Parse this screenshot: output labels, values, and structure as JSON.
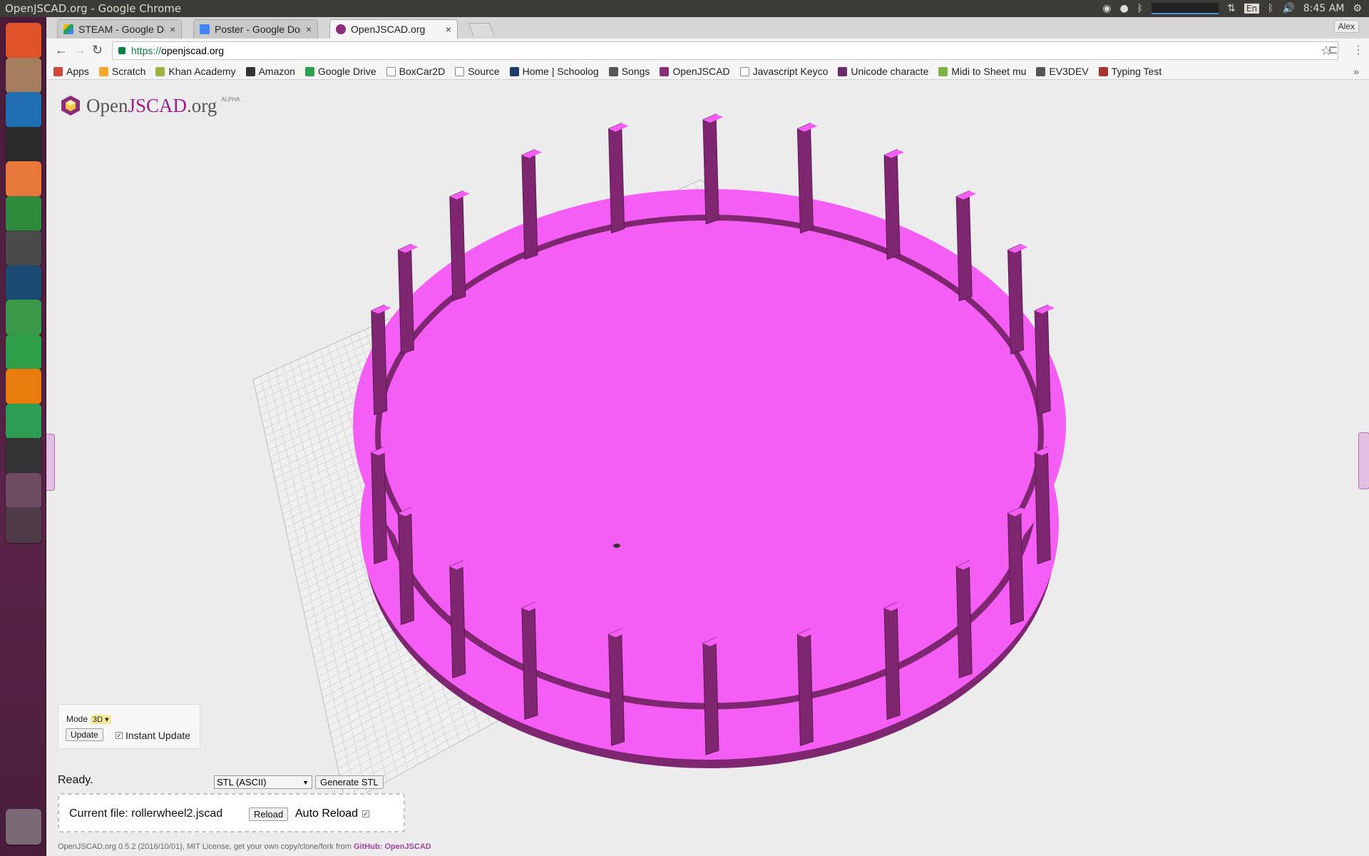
{
  "window": {
    "title": "OpenJSCAD.org - Google Chrome"
  },
  "tray": {
    "keyboard": "En",
    "time": "8:45 AM"
  },
  "tabs": [
    {
      "label": "STEAM - Google Dri",
      "favicon": "google-drive-icon",
      "close": "×"
    },
    {
      "label": "Poster - Google Doc",
      "favicon": "google-docs-icon",
      "close": "×"
    },
    {
      "label": "OpenJSCAD.org",
      "favicon": "openjscad-icon",
      "close": "×",
      "active": true
    }
  ],
  "profile": {
    "name": "Alex"
  },
  "address": {
    "protocol": "https://",
    "host": "openjscad.org"
  },
  "bookmarks": [
    {
      "label": "Apps",
      "icon": "apps-grid-icon",
      "color": "#d04a3a"
    },
    {
      "label": "Scratch",
      "icon": "scratch-icon",
      "color": "#f7a531"
    },
    {
      "label": "Khan Academy",
      "icon": "khan-icon",
      "color": "#9cb443"
    },
    {
      "label": "Amazon",
      "icon": "amazon-icon",
      "color": "#333333"
    },
    {
      "label": "Google Drive",
      "icon": "google-drive-icon",
      "color": "#2ca24c"
    },
    {
      "label": "BoxCar2D",
      "icon": "page-icon",
      "color": "#ffffff"
    },
    {
      "label": "Source",
      "icon": "page-icon",
      "color": "#ffffff"
    },
    {
      "label": "Home | Schoolog",
      "icon": "schoology-icon",
      "color": "#1e3d6b"
    },
    {
      "label": "Songs",
      "icon": "folder-icon",
      "color": "#555555"
    },
    {
      "label": "OpenJSCAD",
      "icon": "openjscad-icon",
      "color": "#8c2d7a"
    },
    {
      "label": "Javascript Keyco",
      "icon": "page-icon",
      "color": "#ffffff"
    },
    {
      "label": "Unicode characte",
      "icon": "unicode-icon",
      "color": "#6a2c6a"
    },
    {
      "label": "Midi to Sheet mu",
      "icon": "midi-icon",
      "color": "#7cb342"
    },
    {
      "label": "EV3DEV",
      "icon": "folder-icon",
      "color": "#555555"
    },
    {
      "label": "Typing Test",
      "icon": "typing-icon",
      "color": "#a33"
    }
  ],
  "app": {
    "logo_text_a": "Open",
    "logo_text_b": "JSCAD",
    "logo_text_c": ".org",
    "logo_tag": "ALPHA",
    "mode_label": "Mode",
    "mode_value": "3D ▾",
    "update_label": "Update",
    "instant_update_label": "Instant Update",
    "instant_update_checked": "✓",
    "status": "Ready.",
    "format_value": "STL (ASCII)",
    "generate_label": "Generate STL",
    "current_file": "Current file: rollerwheel2.jscad",
    "reload_label": "Reload",
    "auto_reload_label": "Auto Reload",
    "auto_reload_checked": "✓",
    "footer_text": "OpenJSCAD.org 0.5.2 (2016/10/01), MIT License, get your own copy/clone/fork from ",
    "footer_link": "GitHub: OpenJSCAD"
  },
  "model": {
    "color": "#f55ef5",
    "shade": "#7e2670",
    "grid_color": "#c8c8c8"
  },
  "launcher": [
    {
      "name": "ubuntu-dash-icon",
      "color": "#e0532a"
    },
    {
      "name": "files-icon",
      "color": "#a67d5d"
    },
    {
      "name": "vnc-viewer-icon",
      "color": "#1f6fb2"
    },
    {
      "name": "xterm-icon",
      "color": "#2b2b2b"
    },
    {
      "name": "file-manager-icon",
      "color": "#e8793b"
    },
    {
      "name": "chrome-icon",
      "color": "#2e8b3c"
    },
    {
      "name": "sublime-text-icon",
      "color": "#4a4a4a"
    },
    {
      "name": "steam-icon",
      "color": "#1b4a72"
    },
    {
      "name": "android-studio-icon",
      "color": "#3b9a4a"
    },
    {
      "name": "hangouts-icon",
      "color": "#2e9e48"
    },
    {
      "name": "blender-icon",
      "color": "#e87d0d"
    },
    {
      "name": "cura-icon",
      "color": "#2d9d53"
    },
    {
      "name": "inkscape-icon",
      "color": "#333333"
    },
    {
      "name": "workspace-switcher-icon",
      "color": "#6d4c63"
    },
    {
      "name": "phone-icon",
      "color": "#4e3b47"
    }
  ]
}
